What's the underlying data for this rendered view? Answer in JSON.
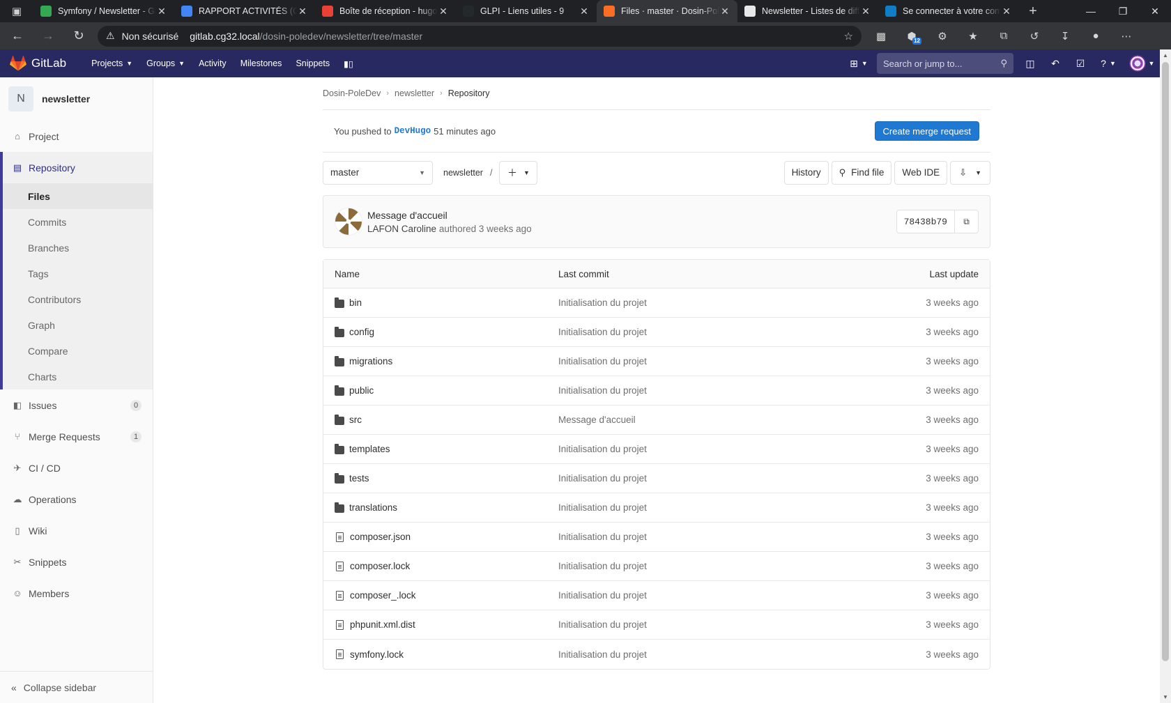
{
  "browser": {
    "tabs": [
      {
        "title": "Symfony / Newsletter - GitLab",
        "favicon": "drive-icon",
        "color": "#34a853"
      },
      {
        "title": "RAPPORT ACTIVITÉS (Comp…",
        "favicon": "docs-icon",
        "color": "#4285f4"
      },
      {
        "title": "Boîte de réception - hugo",
        "favicon": "gmail-icon",
        "color": "#ea4335"
      },
      {
        "title": "GLPI - Liens utiles - 9",
        "favicon": "github-icon",
        "color": "#24292e"
      },
      {
        "title": "Files · master · Dosin-PoleDev",
        "favicon": "gitlab-icon",
        "color": "#fc6d26"
      },
      {
        "title": "Newsletter - Listes de diffusion",
        "favicon": "page-icon",
        "color": "#e8e8e8"
      },
      {
        "title": "Se connecter à votre compte",
        "favicon": "edge-icon",
        "color": "#0f7ec6"
      }
    ],
    "active_tab": 4,
    "address": {
      "security": "Non sécurisé",
      "host": "gitlab.cg32.local",
      "path": "/dosin-poledev/newsletter/tree/master"
    },
    "extension_badge": "12"
  },
  "gitlab_header": {
    "brand": "GitLab",
    "nav": [
      {
        "label": "Projects",
        "dropdown": true
      },
      {
        "label": "Groups",
        "dropdown": true
      },
      {
        "label": "Activity",
        "dropdown": false
      },
      {
        "label": "Milestones",
        "dropdown": false
      },
      {
        "label": "Snippets",
        "dropdown": false
      }
    ],
    "search_placeholder": "Search or jump to..."
  },
  "sidebar": {
    "project_initial": "N",
    "project_name": "newsletter",
    "project_item": "Project",
    "repository": {
      "label": "Repository",
      "items": [
        "Files",
        "Commits",
        "Branches",
        "Tags",
        "Contributors",
        "Graph",
        "Compare",
        "Charts"
      ],
      "active": "Files"
    },
    "items": [
      {
        "label": "Issues",
        "icon": "issues-icon",
        "count": "0"
      },
      {
        "label": "Merge Requests",
        "icon": "merge-request-icon",
        "count": "1"
      },
      {
        "label": "CI / CD",
        "icon": "rocket-icon",
        "count": null
      },
      {
        "label": "Operations",
        "icon": "cloud-gear-icon",
        "count": null
      },
      {
        "label": "Wiki",
        "icon": "book-icon",
        "count": null
      },
      {
        "label": "Snippets",
        "icon": "scissors-icon",
        "count": null
      },
      {
        "label": "Members",
        "icon": "users-icon",
        "count": null
      }
    ],
    "collapse": "Collapse sidebar"
  },
  "breadcrumb": [
    "Dosin-PoleDev",
    "newsletter",
    "Repository"
  ],
  "push_banner": {
    "prefix": "You pushed to",
    "branch": "DevHugo",
    "suffix": "51 minutes ago",
    "button": "Create merge request"
  },
  "tree_controls": {
    "ref": "master",
    "path": "newsletter",
    "separator": "/",
    "history": "History",
    "find_file": "Find file",
    "web_ide": "Web IDE"
  },
  "last_commit": {
    "title": "Message d'accueil",
    "author": "LAFON Caroline",
    "meta": "authored 3 weeks ago",
    "sha": "78438b79"
  },
  "file_table": {
    "headers": {
      "name": "Name",
      "commit": "Last commit",
      "update": "Last update"
    },
    "rows": [
      {
        "name": "bin",
        "type": "folder",
        "commit": "Initialisation du projet",
        "update": "3 weeks ago"
      },
      {
        "name": "config",
        "type": "folder",
        "commit": "Initialisation du projet",
        "update": "3 weeks ago"
      },
      {
        "name": "migrations",
        "type": "folder",
        "commit": "Initialisation du projet",
        "update": "3 weeks ago"
      },
      {
        "name": "public",
        "type": "folder",
        "commit": "Initialisation du projet",
        "update": "3 weeks ago"
      },
      {
        "name": "src",
        "type": "folder",
        "commit": "Message d'accueil",
        "update": "3 weeks ago"
      },
      {
        "name": "templates",
        "type": "folder",
        "commit": "Initialisation du projet",
        "update": "3 weeks ago"
      },
      {
        "name": "tests",
        "type": "folder",
        "commit": "Initialisation du projet",
        "update": "3 weeks ago"
      },
      {
        "name": "translations",
        "type": "folder",
        "commit": "Initialisation du projet",
        "update": "3 weeks ago"
      },
      {
        "name": "composer.json",
        "type": "file",
        "commit": "Initialisation du projet",
        "update": "3 weeks ago"
      },
      {
        "name": "composer.lock",
        "type": "file",
        "commit": "Initialisation du projet",
        "update": "3 weeks ago"
      },
      {
        "name": "composer_.lock",
        "type": "file",
        "commit": "Initialisation du projet",
        "update": "3 weeks ago"
      },
      {
        "name": "phpunit.xml.dist",
        "type": "file",
        "commit": "Initialisation du projet",
        "update": "3 weeks ago"
      },
      {
        "name": "symfony.lock",
        "type": "file",
        "commit": "Initialisation du projet",
        "update": "3 weeks ago"
      }
    ]
  },
  "colors": {
    "gitlab_header": "#292961",
    "primary_button": "#1f78d1",
    "sidebar_active_border": "#3e3b9b"
  }
}
